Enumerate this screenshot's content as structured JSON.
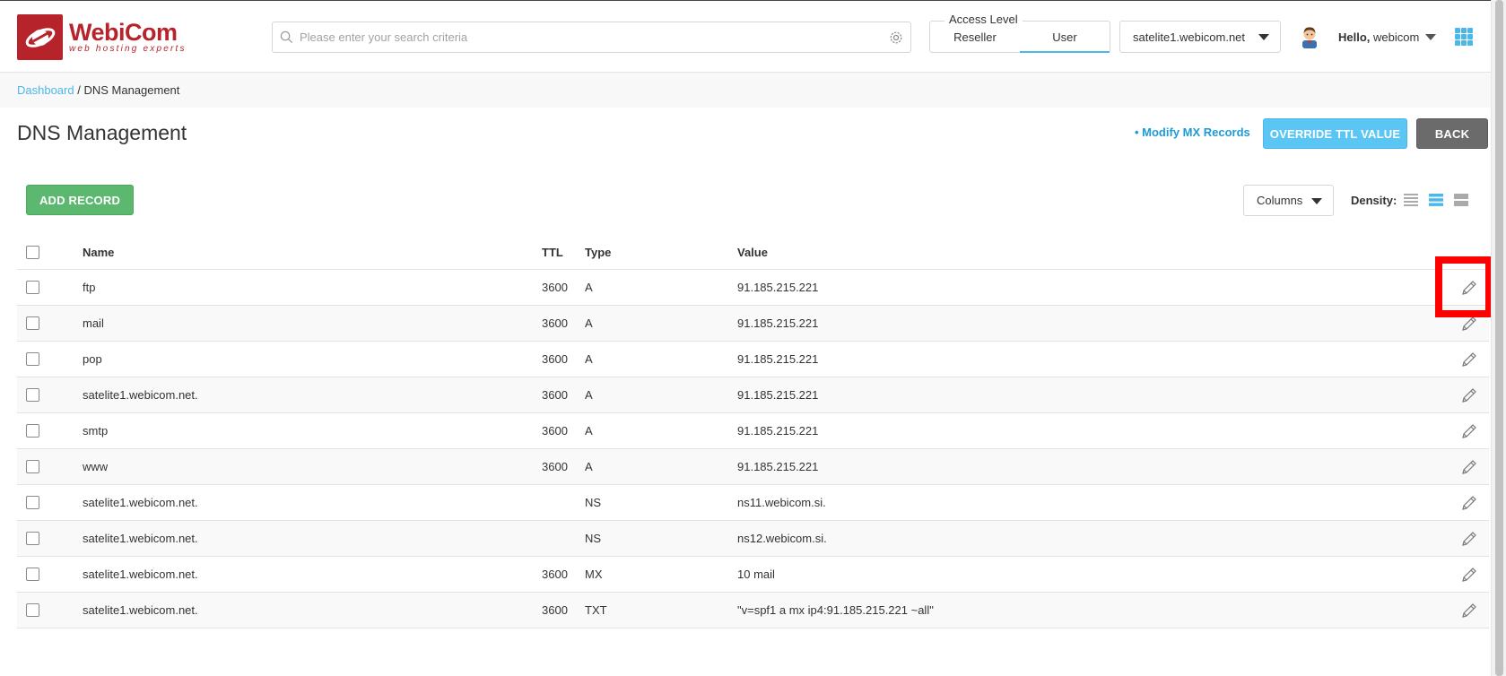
{
  "header": {
    "logo_name": "WebiCom",
    "logo_tagline": "web hosting experts",
    "search_placeholder": "Please enter your search criteria",
    "access_level_label": "Access Level",
    "access_options": [
      "Reseller",
      "User"
    ],
    "access_selected": "User",
    "server_selected": "satelite1.webicom.net",
    "greeting": "Hello,",
    "username": "webicom"
  },
  "breadcrumb": {
    "root": "Dashboard",
    "separator": " / ",
    "current": "DNS Management"
  },
  "page": {
    "title": "DNS Management",
    "modify_mx_link": "• Modify MX Records",
    "override_ttl_button": "OVERRIDE TTL VALUE",
    "back_button": "BACK",
    "add_record_button": "ADD RECORD",
    "columns_button": "Columns",
    "density_label": "Density:"
  },
  "table": {
    "headers": {
      "name": "Name",
      "ttl": "TTL",
      "type": "Type",
      "value": "Value"
    },
    "rows": [
      {
        "name": "ftp",
        "ttl": "3600",
        "type": "A",
        "value": "91.185.215.221"
      },
      {
        "name": "mail",
        "ttl": "3600",
        "type": "A",
        "value": "91.185.215.221"
      },
      {
        "name": "pop",
        "ttl": "3600",
        "type": "A",
        "value": "91.185.215.221"
      },
      {
        "name": "satelite1.webicom.net.",
        "ttl": "3600",
        "type": "A",
        "value": "91.185.215.221"
      },
      {
        "name": "smtp",
        "ttl": "3600",
        "type": "A",
        "value": "91.185.215.221"
      },
      {
        "name": "www",
        "ttl": "3600",
        "type": "A",
        "value": "91.185.215.221"
      },
      {
        "name": "satelite1.webicom.net.",
        "ttl": "",
        "type": "NS",
        "value": "ns11.webicom.si."
      },
      {
        "name": "satelite1.webicom.net.",
        "ttl": "",
        "type": "NS",
        "value": "ns12.webicom.si."
      },
      {
        "name": "satelite1.webicom.net.",
        "ttl": "3600",
        "type": "MX",
        "value": "10 mail"
      },
      {
        "name": "satelite1.webicom.net.",
        "ttl": "3600",
        "type": "TXT",
        "value": "\"v=spf1 a mx ip4:91.185.215.221 ~all\""
      }
    ]
  },
  "colors": {
    "brand_red": "#b7232a",
    "accent_blue": "#4bb8ea",
    "add_green": "#5cb86e",
    "back_gray": "#6b6b6b",
    "highlight_red": "#ff0000"
  },
  "icons": [
    "search-icon",
    "gear-icon",
    "chevron-down-icon",
    "avatar",
    "apps-grid-icon",
    "density-compact-icon",
    "density-standard-icon",
    "density-comfortable-icon",
    "pencil-icon"
  ]
}
